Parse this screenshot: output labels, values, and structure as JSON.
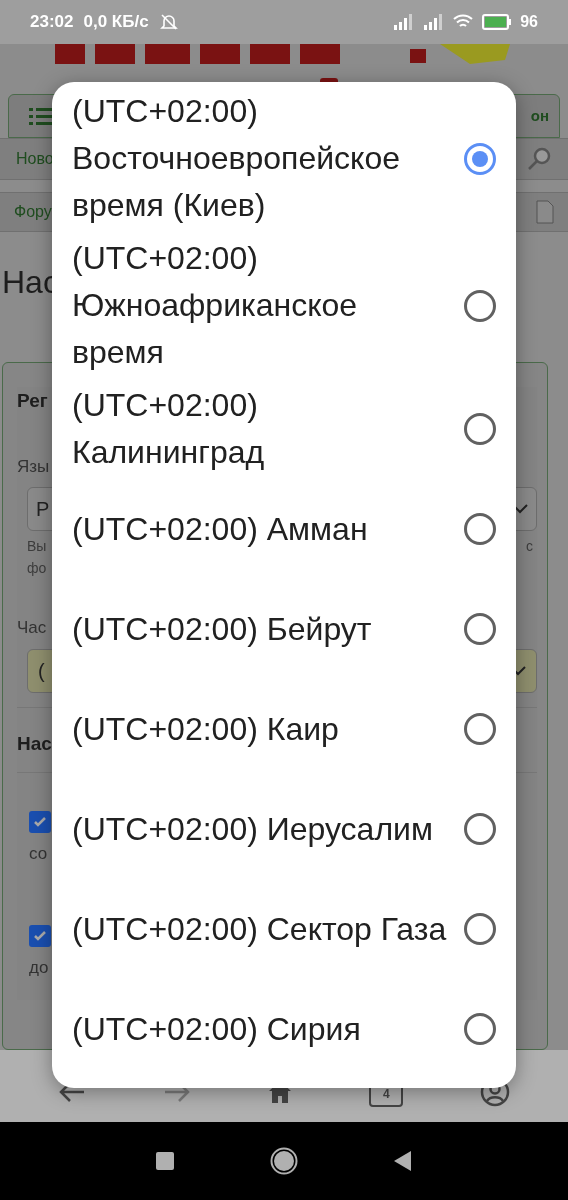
{
  "status_bar": {
    "time": "23:02",
    "speed": "0,0 КБ/с",
    "battery": "96"
  },
  "page": {
    "tab_right": "он",
    "search_bar": "Ново",
    "forum_bar": "Фору",
    "heading": "Нас",
    "section_1": "Рег",
    "language_label": "Язы",
    "language_value": "Р",
    "hint_left_1": "Вы",
    "hint_left_2": "фо",
    "hint_right": "с",
    "timezone_label": "Час",
    "timezone_value": "(",
    "section_2": "Нас",
    "options": [
      {
        "checked": true,
        "text": "со"
      },
      {
        "checked": true,
        "text": "до"
      }
    ]
  },
  "browser_bar": {
    "tabs_count": "4"
  },
  "dialog": {
    "options": [
      {
        "label": "(UTC+02:00) Восточноевропейское время (Киев)",
        "selected": true
      },
      {
        "label": "(UTC+02:00) Южноафриканское время",
        "selected": false
      },
      {
        "label": "(UTC+02:00) Калининград",
        "selected": false
      },
      {
        "label": "(UTC+02:00) Амман",
        "selected": false
      },
      {
        "label": "(UTC+02:00) Бейрут",
        "selected": false
      },
      {
        "label": "(UTC+02:00) Каир",
        "selected": false
      },
      {
        "label": "(UTC+02:00) Иерусалим",
        "selected": false
      },
      {
        "label": "(UTC+02:00) Сектор Газа",
        "selected": false
      },
      {
        "label": "(UTC+02:00) Сирия",
        "selected": false
      }
    ]
  }
}
